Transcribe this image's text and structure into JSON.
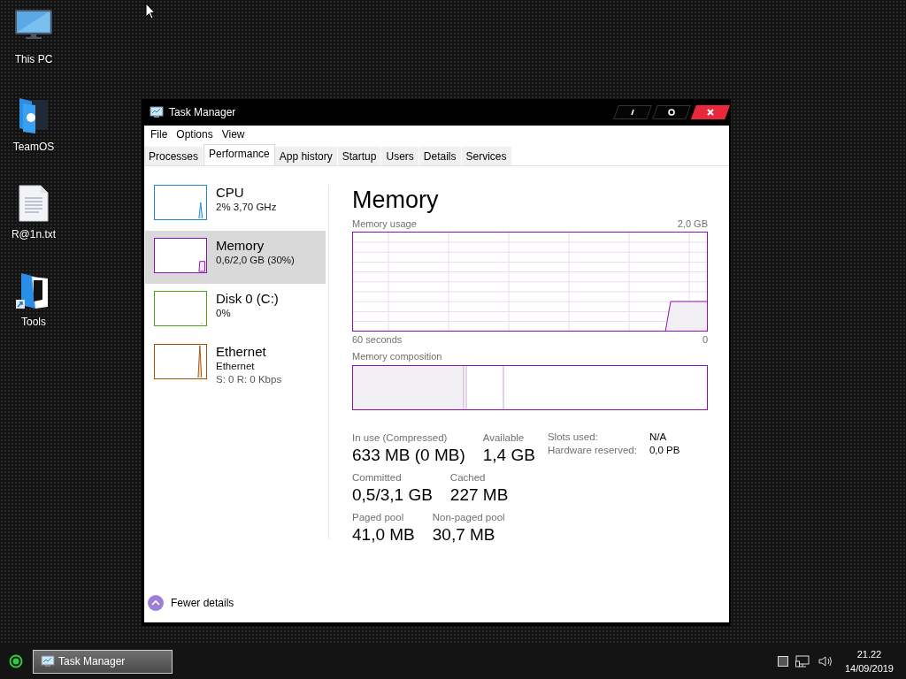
{
  "desktop": {
    "icons": [
      {
        "label": "This PC",
        "kind": "computer"
      },
      {
        "label": "TeamOS",
        "kind": "folder"
      },
      {
        "label": "R@1n.txt",
        "kind": "text-file"
      },
      {
        "label": "Tools",
        "kind": "shortcut-folder"
      }
    ]
  },
  "window": {
    "title": "Task Manager",
    "menu": [
      "File",
      "Options",
      "View"
    ],
    "tabs": [
      {
        "label": "Processes",
        "selected": false
      },
      {
        "label": "Performance",
        "selected": true
      },
      {
        "label": "App history",
        "selected": false
      },
      {
        "label": "Startup",
        "selected": false
      },
      {
        "label": "Users",
        "selected": false
      },
      {
        "label": "Details",
        "selected": false
      },
      {
        "label": "Services",
        "selected": false
      }
    ],
    "sidebar": {
      "items": [
        {
          "name": "CPU",
          "kind": "cpu",
          "color": "#1c87c9",
          "selected": false,
          "lines": [
            "2% 3,70 GHz"
          ]
        },
        {
          "name": "Memory",
          "kind": "memory",
          "color": "#8b12ae",
          "selected": true,
          "lines": [
            "0,6/2,0 GB (30%)"
          ]
        },
        {
          "name": "Disk 0 (C:)",
          "kind": "disk",
          "color": "#4da60c",
          "selected": false,
          "lines": [
            "0%"
          ]
        },
        {
          "name": "Ethernet",
          "kind": "network",
          "color": "#a74f01",
          "selected": false,
          "lines": [
            "Ethernet",
            "S: 0 R: 0 Kbps"
          ]
        }
      ]
    },
    "detail": {
      "title": "Memory",
      "usage_graph": {
        "label": "Memory usage",
        "max": "2,0 GB",
        "time_span": "60 seconds",
        "min": "0"
      },
      "composition": {
        "label": "Memory composition"
      },
      "stats": [
        [
          {
            "label": "In use (Compressed)",
            "value": "633 MB (0 MB)"
          },
          {
            "label": "Available",
            "value": "1,4 GB"
          }
        ],
        [
          {
            "label": "Committed",
            "value": "0,5/3,1 GB"
          },
          {
            "label": "Cached",
            "value": "227 MB"
          }
        ],
        [
          {
            "label": "Paged pool",
            "value": "41,0 MB"
          },
          {
            "label": "Non-paged pool",
            "value": "30,7 MB"
          }
        ]
      ],
      "properties": [
        {
          "label": "Slots used:",
          "value": "N/A"
        },
        {
          "label": "Hardware reserved:",
          "value": "0,0 PB"
        }
      ]
    },
    "footer": {
      "label": "Fewer details"
    }
  },
  "taskbar": {
    "tasks": [
      {
        "label": "Task Manager",
        "selected": true
      }
    ],
    "clock": {
      "time": "21.22",
      "date": "14/09/2019"
    }
  }
}
